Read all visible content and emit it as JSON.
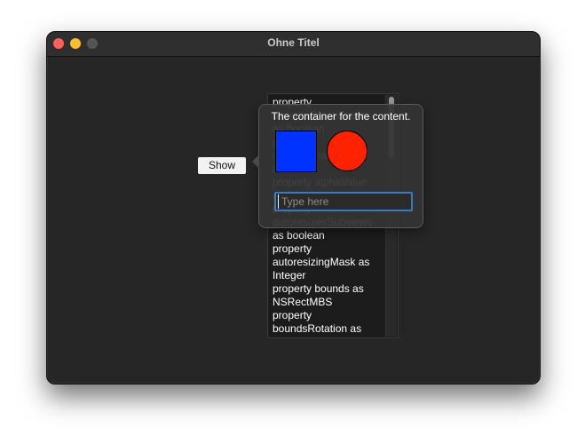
{
  "window": {
    "title": "Ohne Titel"
  },
  "show_button": {
    "label": "Show"
  },
  "list": {
    "text": "property\nacceptsTouchEvents\nas boolean\nproperty\nallowsVibrancy as\nboolean\nproperty alphaValue\nas Double\nproperty\nautoresizesSubviews\nas boolean\nproperty\nautoresizingMask as\nInteger\nproperty bounds as\nNSRectMBS\nproperty\nboundsRotation as\nDouble"
  },
  "popover": {
    "title": "The container for the content.",
    "input": {
      "placeholder": "Type here",
      "value": ""
    },
    "shapes": {
      "square_color": "#0033ff",
      "circle_color": "#ff2200"
    }
  },
  "colors": {
    "close": "#fe5f57",
    "minimize": "#febc2e",
    "zoom_disabled": "#555555",
    "focus_ring": "#3a79c2"
  }
}
